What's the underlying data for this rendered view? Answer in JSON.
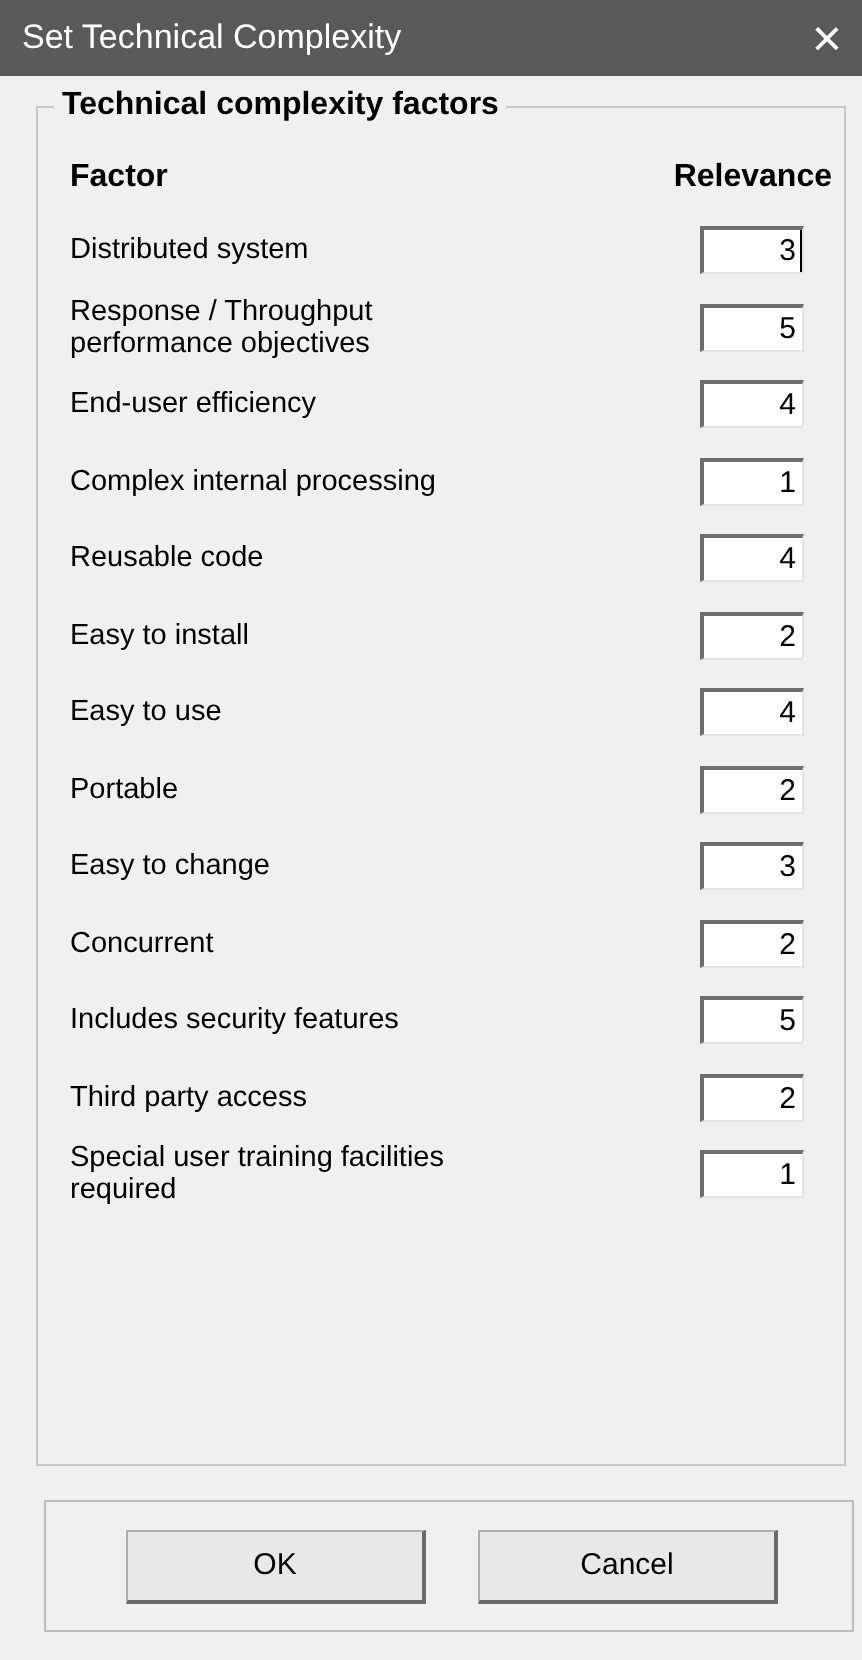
{
  "window": {
    "title": "Set Technical Complexity",
    "close": "×"
  },
  "group": {
    "title": "Technical complexity factors",
    "columns": [
      "Factor",
      "Relevance"
    ],
    "rows": [
      {
        "factor": "Distributed system",
        "value": "3",
        "focused": true
      },
      {
        "factor": "Response / Throughput performance objectives",
        "value": "5",
        "focused": false
      },
      {
        "factor": "End-user efficiency",
        "value": "4",
        "focused": false
      },
      {
        "factor": "Complex internal processing",
        "value": "1",
        "focused": false
      },
      {
        "factor": "Reusable code",
        "value": "4",
        "focused": false
      },
      {
        "factor": "Easy to install",
        "value": "2",
        "focused": false
      },
      {
        "factor": "Easy to use",
        "value": "4",
        "focused": false
      },
      {
        "factor": "Portable",
        "value": "2",
        "focused": false
      },
      {
        "factor": "Easy to change",
        "value": "3",
        "focused": false
      },
      {
        "factor": "Concurrent",
        "value": "2",
        "focused": false
      },
      {
        "factor": "Includes security features",
        "value": "5",
        "focused": false
      },
      {
        "factor": "Third party access",
        "value": "2",
        "focused": false
      },
      {
        "factor": "Special user training facilities required",
        "value": "1",
        "focused": false
      }
    ]
  },
  "buttons": [
    "OK",
    "Cancel"
  ]
}
